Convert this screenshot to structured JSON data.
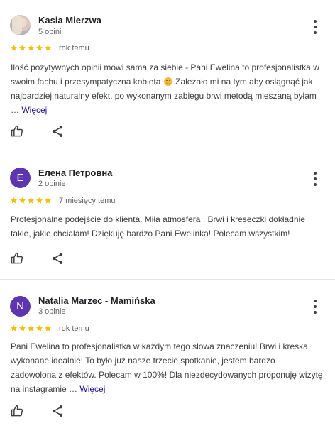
{
  "colors": {
    "star": "#fbbc04",
    "avatar_purple": "#5e35b1",
    "link": "#1a0dab",
    "divider": "#e3e3e3"
  },
  "reviews": [
    {
      "author": "Kasia Mierzwa",
      "review_count": "5 opinii",
      "avatar": "photo",
      "rating": 5,
      "time": "rok temu",
      "text": "Ilość pozytywnych opinii mówi sama za siebie - Pani Ewelina to profesjonalistka w swoim fachu i przesympatyczna kobieta",
      "emoji": "smiling-face-emoji",
      "text_after_emoji": " Zależało mi na tym aby osiągnąć jak najbardziej naturalny efekt, po wykonanym zabiegu brwi metodą mieszaną byłam … ",
      "more_label": "Więcej",
      "like_icon": "thumbs-up-icon",
      "share_icon": "share-icon"
    },
    {
      "author": "Елена Петровна",
      "review_count": "2 opinie",
      "avatar": "letter",
      "avatar_letter": "E",
      "rating": 5,
      "time": "7 miesięcy temu",
      "text": "Profesjonalne podejście do klienta. Miła atmosfera . Brwi i kreseczki dokładnie takie, jakie chciałam! Dziękuję bardzo Pani Ewelinka! Polecam wszystkim!",
      "like_icon": "thumbs-up-icon",
      "share_icon": "share-icon"
    },
    {
      "author": "Natalia Marzec - Mamińska",
      "review_count": "3 opinie",
      "avatar": "letter",
      "avatar_letter": "N",
      "rating": 5,
      "time": "rok temu",
      "text": "Pani Ewelina to profesjonalistka w każdym tego słowa znaczeniu! Brwi i kreska wykonane idealnie! To było już nasze trzecie spotkanie, jestem bardzo zadowolona z efektów. Polecam w 100%! Dla niezdecydowanych proponuję wizytę na instagramie … ",
      "more_label": "Więcej",
      "like_icon": "thumbs-up-icon",
      "share_icon": "share-icon"
    }
  ]
}
